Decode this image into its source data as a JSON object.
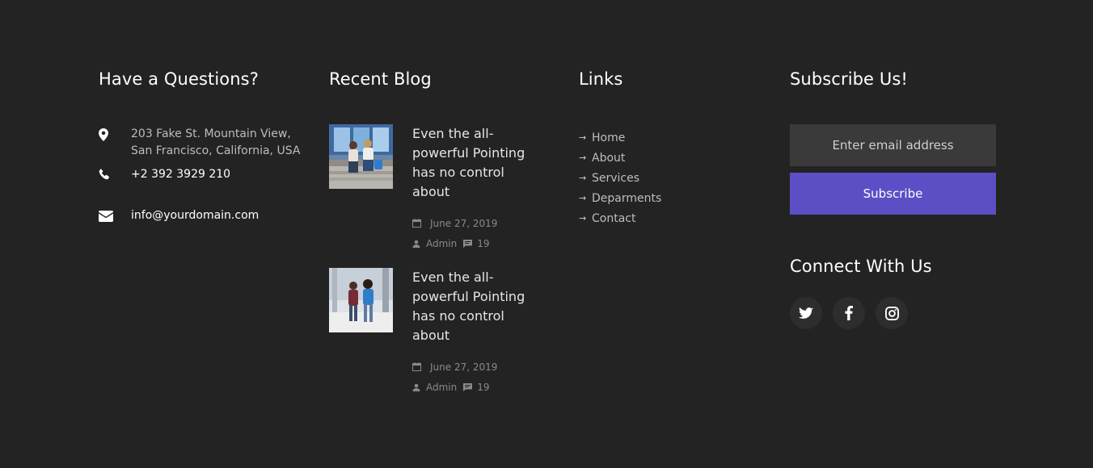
{
  "contact": {
    "title": "Have a Questions?",
    "address_line1": "203 Fake St. Mountain View,",
    "address_line2": "San Francisco, California, USA",
    "phone": "+2 392 3929 210",
    "email": "info@yourdomain.com",
    "icons": [
      "map-marker-icon",
      "phone-icon",
      "envelope-icon"
    ]
  },
  "blog": {
    "title": "Recent Blog",
    "posts": [
      {
        "title": "Even the all-powerful Pointing has no control about",
        "date": "June 27, 2019",
        "author": "Admin",
        "comments": "19"
      },
      {
        "title": "Even the all-powerful Pointing has no control about",
        "date": "June 27, 2019",
        "author": "Admin",
        "comments": "19"
      }
    ]
  },
  "links": {
    "title": "Links",
    "items": [
      "Home",
      "About",
      "Services",
      "Deparments",
      "Contact"
    ]
  },
  "subscribe": {
    "title": "Subscribe Us!",
    "email_placeholder": "Enter email address",
    "button_label": "Subscribe",
    "accent_color": "#5c4fc5"
  },
  "connect": {
    "title": "Connect With Us",
    "icons": [
      "twitter-icon",
      "facebook-icon",
      "instagram-icon"
    ]
  },
  "colors": {
    "background": "#232323",
    "input_background": "#3a3a3a",
    "button": "#5c4fc5"
  }
}
